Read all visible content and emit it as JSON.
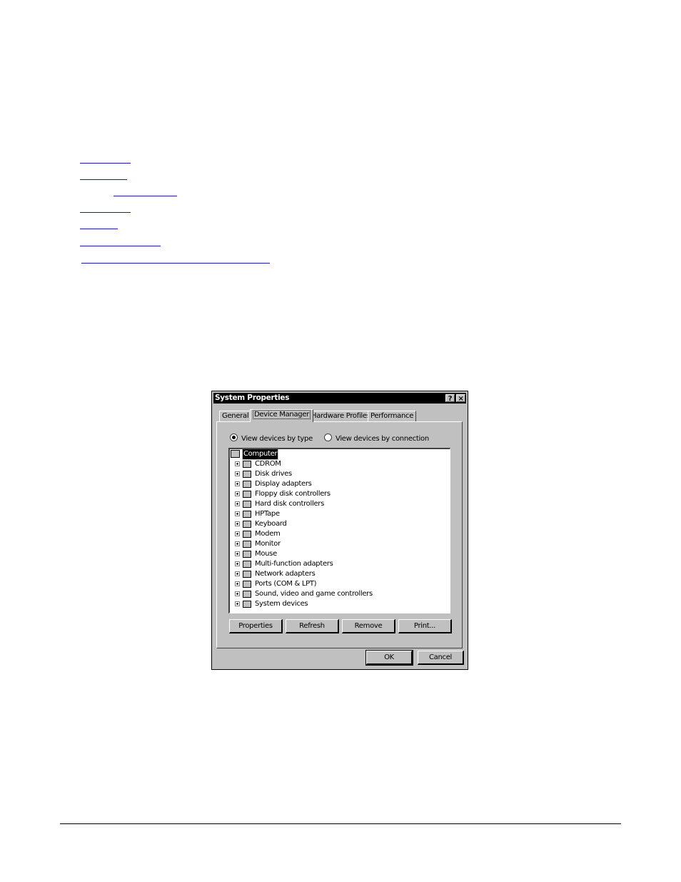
{
  "dialog": {
    "title": "System Properties",
    "title_buttons": {
      "help": "?",
      "close": "×"
    },
    "tabs": [
      "General",
      "Device Manager",
      "Hardware Profiles",
      "Performance"
    ],
    "radio_by_type": "View devices by type",
    "radio_by_connection": "View devices by connection",
    "root": "Computer",
    "devices": [
      "CDROM",
      "Disk drives",
      "Display adapters",
      "Floppy disk controllers",
      "Hard disk controllers",
      "HPTape",
      "Keyboard",
      "Modem",
      "Monitor",
      "Mouse",
      "Multi-function adapters",
      "Network adapters",
      "Ports (COM & LPT)",
      "Sound, video and game controllers",
      "System devices"
    ],
    "buttons": {
      "properties": "Properties",
      "refresh": "Refresh",
      "remove": "Remove",
      "print": "Print...",
      "ok": "OK",
      "cancel": "Cancel"
    }
  }
}
